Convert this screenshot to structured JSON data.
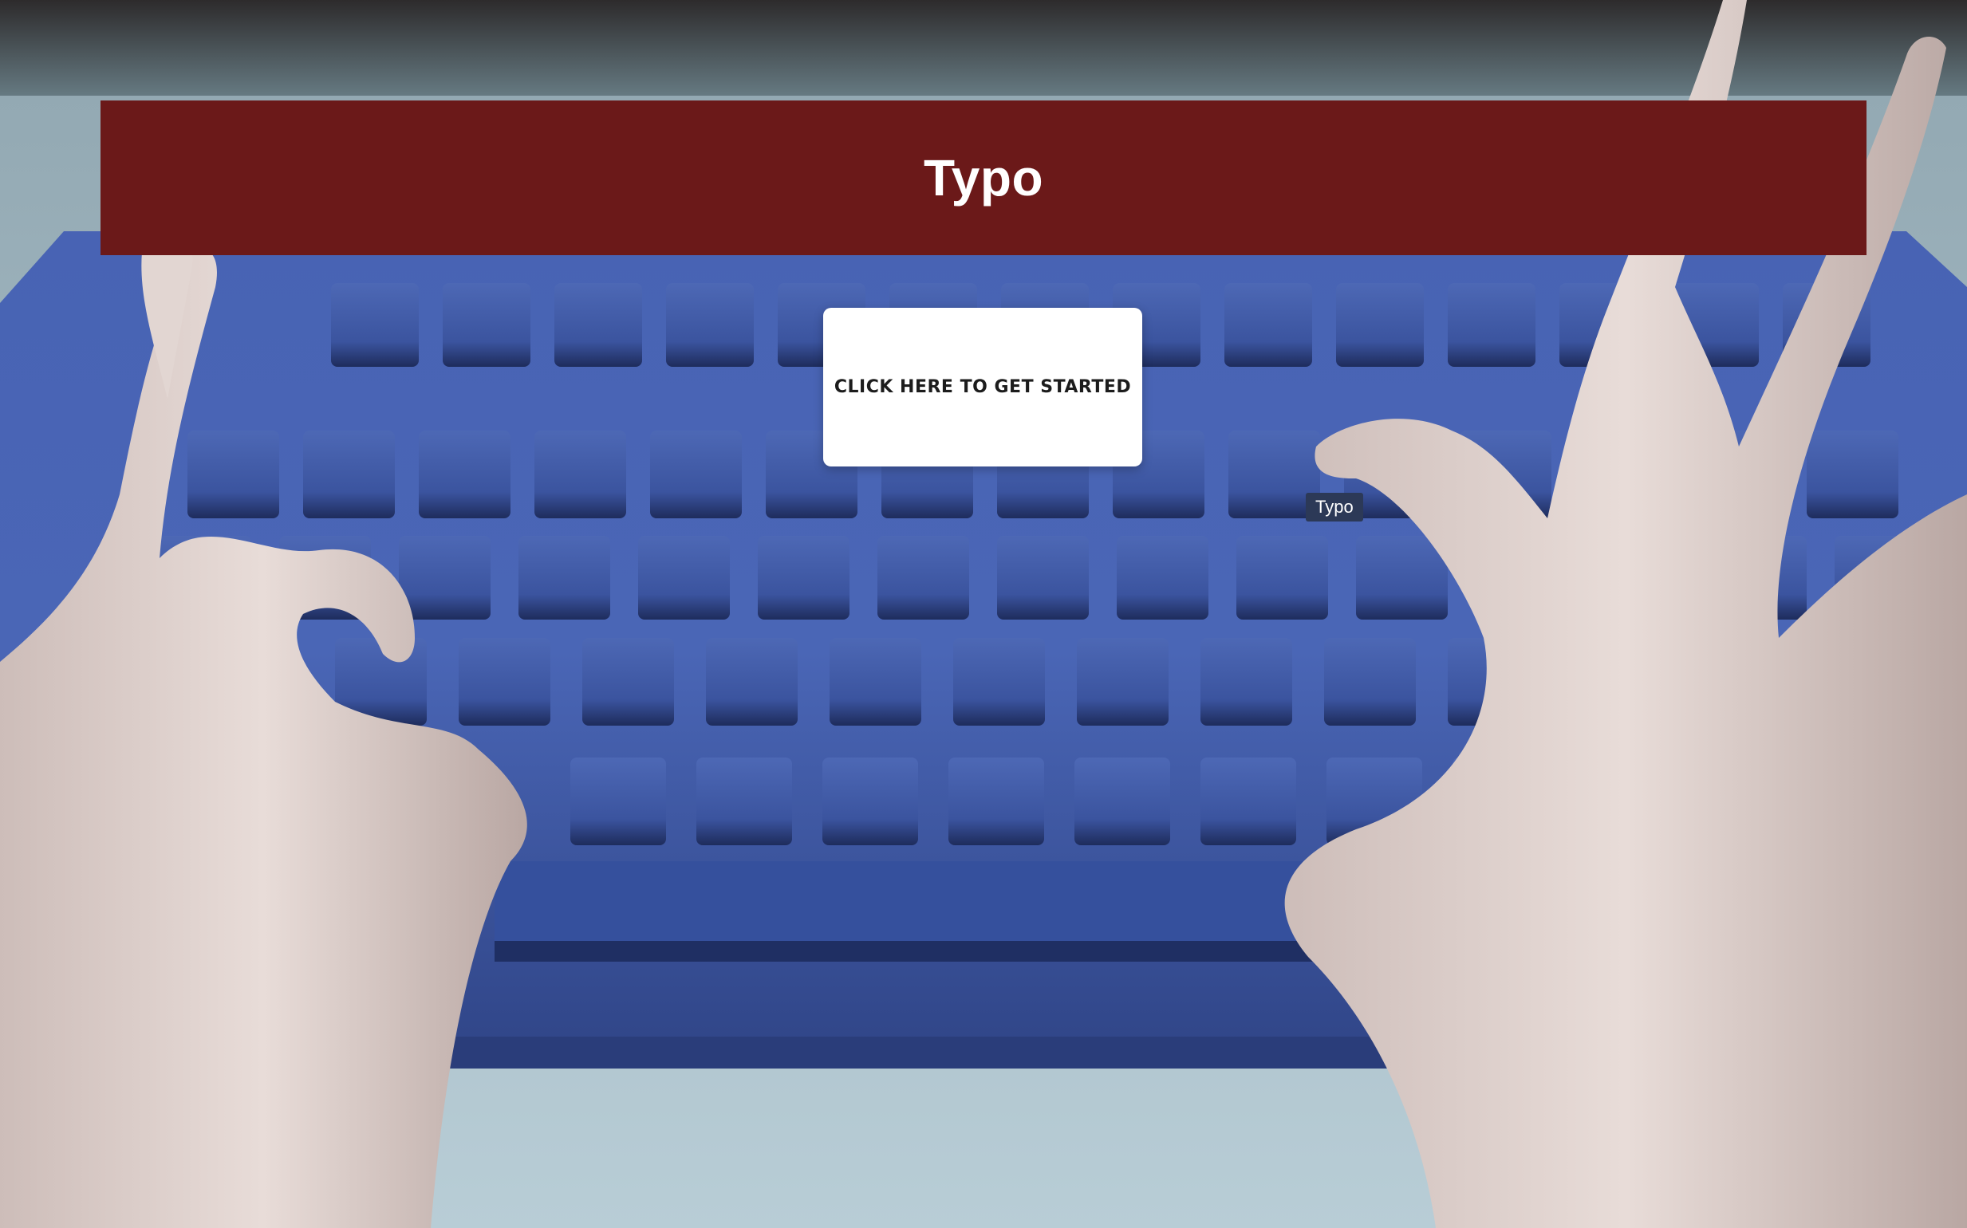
{
  "header": {
    "title": "Typo"
  },
  "hero": {
    "start_button_label": "CLICK HERE TO GET STARTED",
    "tooltip_text": "Typo",
    "background_image": "hands-typing-on-keyboard-illustration"
  },
  "colors": {
    "banner": "#6b1919",
    "button_bg": "#ffffff",
    "keyboard": "#3f5aa8",
    "tooltip_bg": "#2c3957"
  }
}
